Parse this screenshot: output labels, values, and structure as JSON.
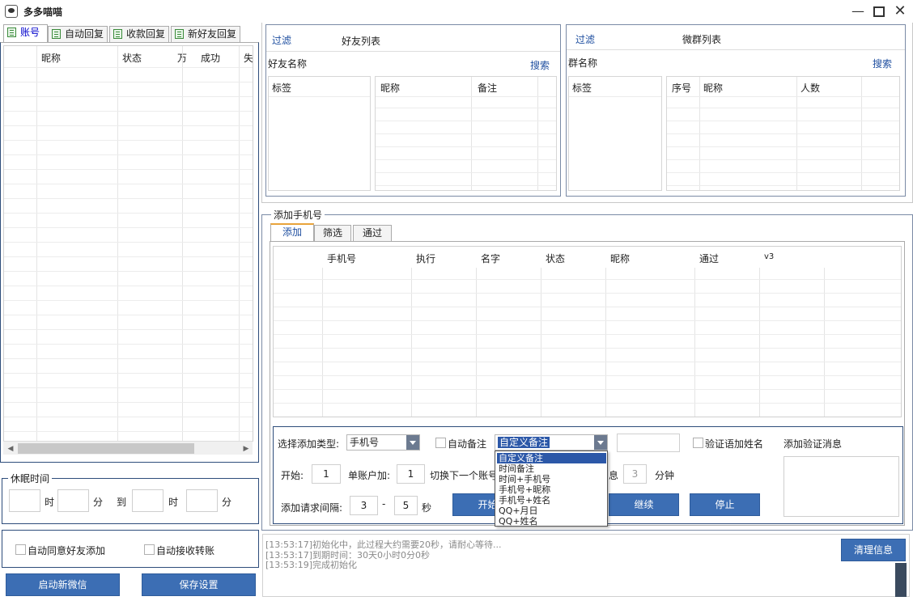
{
  "window": {
    "title": "多多喵喵",
    "controls": [
      "minimize-icon",
      "maximize-icon",
      "close-icon"
    ]
  },
  "left_tabs": [
    "账号",
    "自动回复",
    "收款回复",
    "新好友回复"
  ],
  "account_grid": {
    "columns": [
      "昵称",
      "状态",
      "万",
      "成功",
      "失"
    ]
  },
  "sleep": {
    "legend": "休眠时间",
    "hour_label": "时",
    "minute_label": "分",
    "to_label": "到",
    "hour_label2": "时",
    "minute_label2": "分"
  },
  "options": {
    "auto_accept_friend": "自动同意好友添加",
    "auto_receive_transfer": "自动接收转账"
  },
  "left_buttons": {
    "start_wechat": "启动新微信",
    "save_settings": "保存设置"
  },
  "friends_panel": {
    "filter": "过滤",
    "title": "好友列表",
    "name_label": "好友名称",
    "search": "搜索",
    "tag_header": "标签",
    "columns": [
      "昵称",
      "备注"
    ]
  },
  "groups_panel": {
    "filter": "过滤",
    "title": "微群列表",
    "name_label": "群名称",
    "search": "搜索",
    "tag_header": "标签",
    "columns": [
      "序号",
      "昵称",
      "人数"
    ]
  },
  "add_phone": {
    "legend": "添加手机号",
    "tabs": [
      "添加",
      "筛选",
      "通过"
    ],
    "columns": [
      "手机号",
      "执行",
      "名字",
      "状态",
      "昵称",
      "通过",
      "v3"
    ],
    "type_label": "选择添加类型:",
    "type_value": "手机号",
    "auto_remark": "自动备注",
    "remark_value": "自定义备注",
    "verify_name": "验证语加姓名",
    "verify_msg_label": "添加验证消息",
    "start_label": "开始:",
    "start_value": "1",
    "per_account_label": "单账户加:",
    "per_account_value": "1",
    "switch_label": "切换下一个账号",
    "rest_label_tail": "息",
    "rest_value": "3",
    "minute_unit": "分钟",
    "interval_label": "添加请求间隔:",
    "interval_from": "3",
    "interval_dash": "-",
    "interval_to": "5",
    "second_unit": "秒",
    "start_button": "开始",
    "continue_button": "继续",
    "stop_button": "停止"
  },
  "remark_dropdown": {
    "options": [
      "自定义备注",
      "时间备注",
      "时间+手机号",
      "手机号+昵称",
      "手机号+姓名",
      "QQ+月日",
      "QQ+姓名"
    ],
    "selected": 0
  },
  "log": {
    "lines": [
      "[13:53:17]初始化中，此过程大约需要20秒，请耐心等待...",
      "[13:53:17]到期时间：30天0小时0分0秒",
      "[13:53:19]完成初始化"
    ],
    "clear_button": "清理信息"
  },
  "colors": {
    "accent_button": "#3c6eb4",
    "link_blue": "#1f4fa0",
    "group_border": "#2e4d7b",
    "selection": "#2c58a8"
  }
}
